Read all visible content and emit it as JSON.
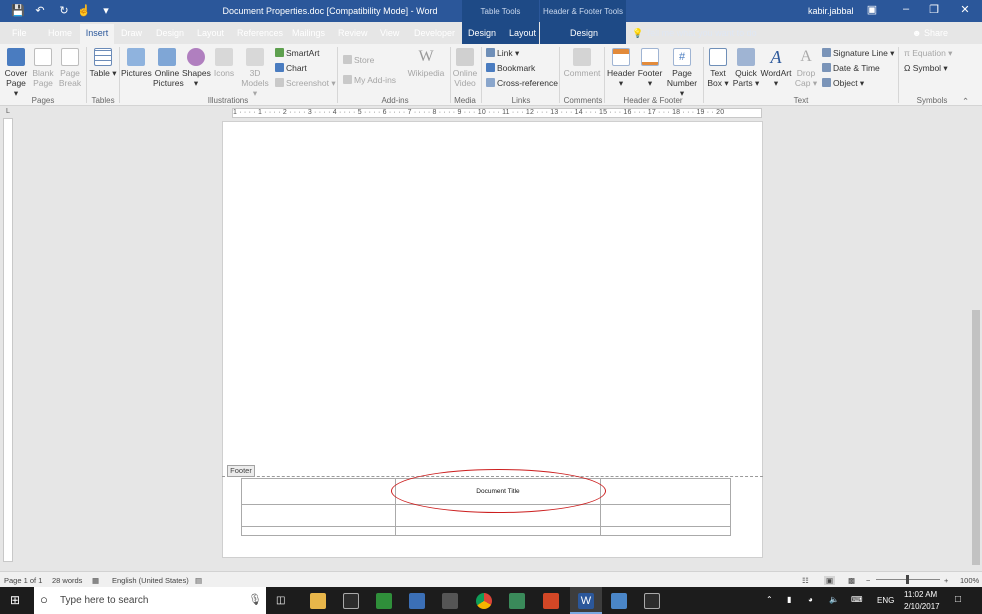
{
  "titlebar": {
    "doc_title": "Document Properties.doc [Compatibility Mode] - Word",
    "context_table_tools": "Table Tools",
    "context_hf_tools": "Header & Footer Tools",
    "user": "kabir.jabbal"
  },
  "tabs": [
    "File",
    "Home",
    "Insert",
    "Draw",
    "Design",
    "Layout",
    "References",
    "Mailings",
    "Review",
    "View",
    "Developer"
  ],
  "context_tabs": {
    "table_design": "Design",
    "table_layout": "Layout",
    "hf_design": "Design"
  },
  "tell_me": "Tell me what you want to do",
  "share": "Share",
  "ribbon": {
    "pages": {
      "group": "Pages",
      "cover_page": "Cover Page ▾",
      "blank_page": "Blank Page",
      "page_break": "Page Break"
    },
    "tables": {
      "group": "Tables",
      "table": "Table ▾"
    },
    "illustrations": {
      "group": "Illustrations",
      "pictures": "Pictures",
      "online_pictures": "Online Pictures",
      "shapes": "Shapes ▾",
      "icons": "Icons",
      "models_3d": "3D Models ▾",
      "smartart": "SmartArt",
      "chart": "Chart",
      "screenshot": "Screenshot ▾"
    },
    "addins": {
      "group": "Add-ins",
      "store": "Store",
      "my_addins": "My Add-ins",
      "wikipedia": "Wikipedia"
    },
    "media": {
      "group": "Media",
      "online_video": "Online Video"
    },
    "links": {
      "group": "Links",
      "link": "Link ▾",
      "bookmark": "Bookmark",
      "cross_reference": "Cross-reference"
    },
    "comments": {
      "group": "Comments",
      "comment": "Comment"
    },
    "header_footer": {
      "group": "Header & Footer",
      "header": "Header ▾",
      "footer": "Footer ▾",
      "page_number": "Page Number ▾"
    },
    "text": {
      "group": "Text",
      "text_box": "Text Box ▾",
      "quick_parts": "Quick Parts ▾",
      "wordart": "WordArt ▾",
      "drop_cap": "Drop Cap ▾",
      "signature_line": "Signature Line ▾",
      "date_time": "Date & Time",
      "object": "Object ▾"
    },
    "symbols": {
      "group": "Symbols",
      "equation": "Equation ▾",
      "symbol": "Symbol ▾"
    }
  },
  "ruler": {
    "horizontal": "1 · · · · 1 · · · · 2 · · · · 3 · · · · 4 · · · · 5 · · · · 6 · · · · 7 · · · · 8 · · · · 9 · · · 10 · · · 11 · · · 12 · · · 13 · · · 14 · · · 15 · · · 16 · · · 17 · · · 18 · · · 19 · · 20",
    "corner": "L"
  },
  "document": {
    "footer_tag": "Footer",
    "footer_title": "Document Title"
  },
  "status": {
    "page": "Page 1 of 1",
    "words": "28 words",
    "language": "English (United States)",
    "zoom": "100%"
  },
  "taskbar": {
    "search_placeholder": "Type here to search",
    "lang": "ENG",
    "time": "11:02 AM",
    "date": "2/10/2017"
  }
}
